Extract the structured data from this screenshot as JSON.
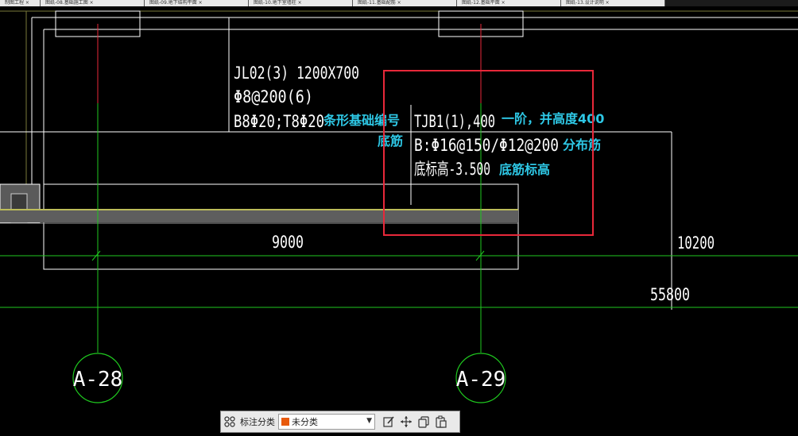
{
  "tabs": [
    {
      "label": "制图工程 ×"
    },
    {
      "label": "图纸-08.基础施工图 ×"
    },
    {
      "label": "图纸-09.地下结构平面 ×"
    },
    {
      "label": "图纸-10.地下室墙柱 ×"
    },
    {
      "label": "图纸-11.基础配筋 ×"
    },
    {
      "label": "图纸-12.基础平面 ×"
    },
    {
      "label": "图纸-13.设计说明 ×"
    }
  ],
  "beam_label": {
    "line1": "JL02(3) 1200X700",
    "line2": "Φ8@200(6)",
    "line3": "B8Φ20;T8Φ20"
  },
  "foundation_label": {
    "code": "TJB1(1),400",
    "rebar": "B:Φ16@150/Φ12@200",
    "elevation": "底标高-3.500"
  },
  "notes": {
    "code_note": "条形基础编号",
    "step_note": "一阶，并高度400",
    "bottom_rebar_note": "底筋",
    "distribution_note": "分布筋",
    "elevation_note": "底筋标高"
  },
  "dimensions": {
    "span_1": "9000",
    "span_2": "10200",
    "total": "55800"
  },
  "axes": {
    "left": "A-28",
    "right": "A-29"
  },
  "toolbar": {
    "category_label": "标注分类",
    "selected_category": "未分类",
    "swatch_color": "#e85a0c"
  },
  "colors": {
    "highlight_box": "#e8283a",
    "annotation": "#2ec8e6",
    "axis_line": "#1fc81f",
    "axis_center": "#e8283a",
    "foundation_band": "#7a7a3a"
  },
  "icons": {
    "category": "grid-icon",
    "edit": "edit-icon",
    "move": "move-icon",
    "copy": "copy-icon",
    "paste": "paste-icon"
  }
}
